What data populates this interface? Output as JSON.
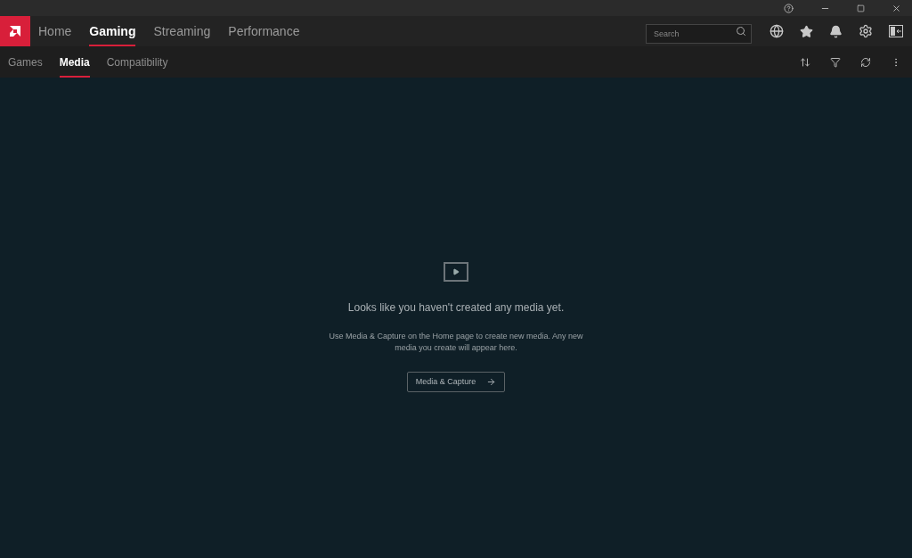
{
  "main_tabs": [
    {
      "label": "Home",
      "selected": false
    },
    {
      "label": "Gaming",
      "selected": true
    },
    {
      "label": "Streaming",
      "selected": false
    },
    {
      "label": "Performance",
      "selected": false
    }
  ],
  "search": {
    "placeholder": "Search"
  },
  "sub_tabs": [
    {
      "label": "Games",
      "selected": false
    },
    {
      "label": "Media",
      "selected": true
    },
    {
      "label": "Compatibility",
      "selected": false
    }
  ],
  "empty_state": {
    "title": "Looks like you haven't created any media yet.",
    "message": "Use Media & Capture on the Home page to create new media. Any new media you create will appear here.",
    "button": "Media & Capture"
  }
}
